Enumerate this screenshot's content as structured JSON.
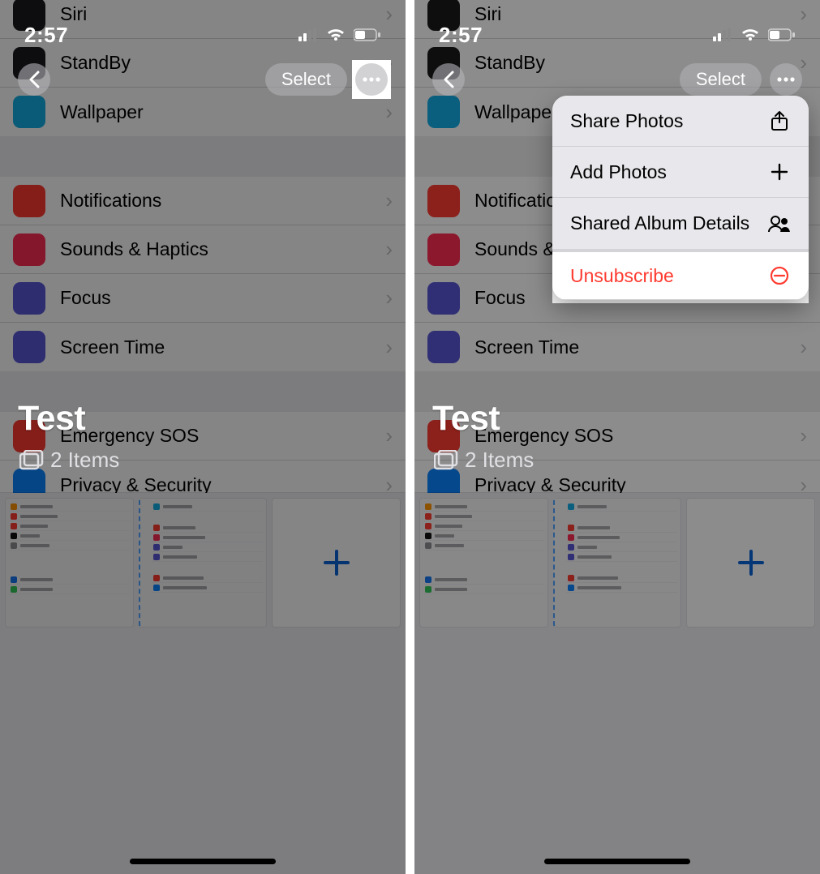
{
  "statusbar": {
    "time": "2:57"
  },
  "topbar": {
    "select_label": "Select"
  },
  "album": {
    "title": "Test",
    "items_label": "2 Items"
  },
  "settings_rows": {
    "siri": "Siri",
    "standby": "StandBy",
    "wallpaper": "Wallpaper",
    "notifications": "Notifications",
    "sounds": "Sounds & Haptics",
    "focus": "Focus",
    "screen_time": "Screen Time",
    "emergency": "Emergency SOS",
    "privacy": "Privacy & Security"
  },
  "thumb_labels": {
    "left": [
      "Calculator",
      "Calculator #",
      "Calendar",
      "Clock",
      "Contacts",
      "Facebook",
      "FaceTime"
    ],
    "right_top": [
      "Wallpaper"
    ],
    "right_mid": [
      "Notifications",
      "Sounds & Haptics",
      "Focus",
      "Screen Time"
    ],
    "right_bot": [
      "Emergency SOS",
      "Privacy & Security"
    ]
  },
  "menu": {
    "share": "Share Photos",
    "add": "Add Photos",
    "details": "Shared Album Details",
    "unsubscribe": "Unsubscribe"
  },
  "colors": {
    "danger": "#ff3b30",
    "siri": "#1a1a1d",
    "standby": "#1a1a1d",
    "wallpaper": "#14aee5",
    "notifications": "#ff3b30",
    "sounds": "#ff2d55",
    "focus": "#5856d6",
    "screentime": "#5856d6",
    "emergency": "#ff3b30",
    "privacy": "#0a84ff"
  }
}
